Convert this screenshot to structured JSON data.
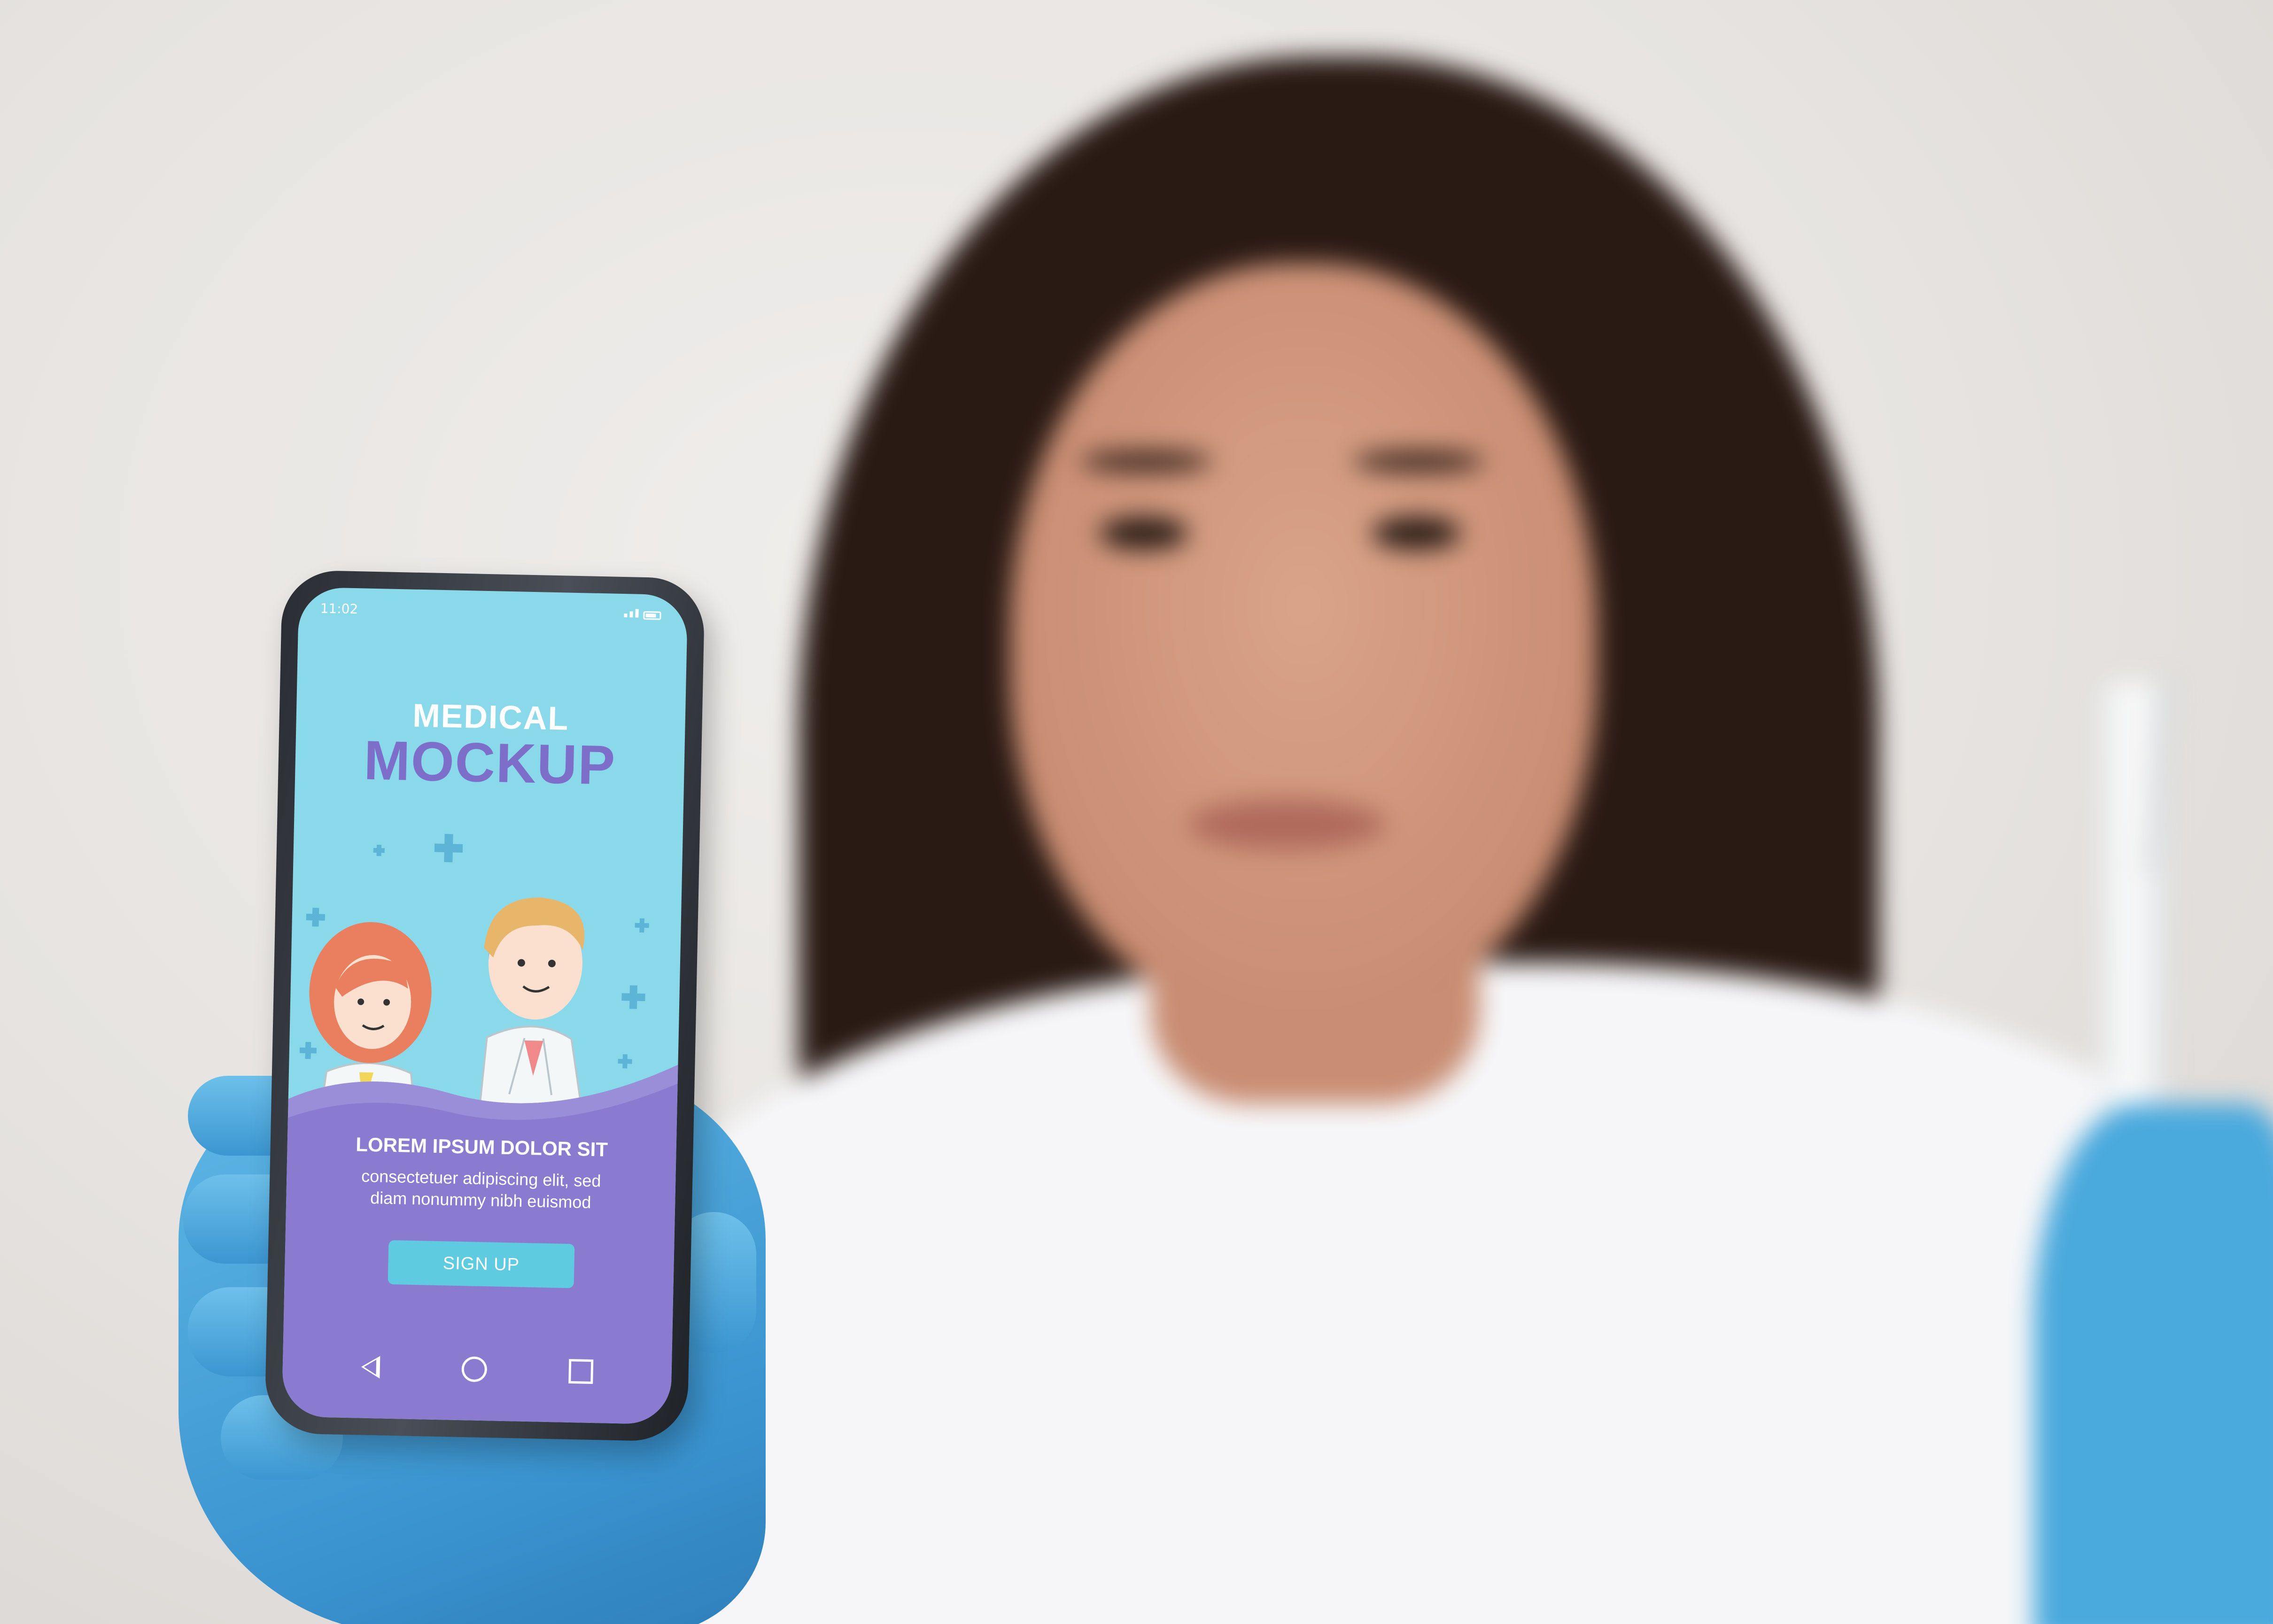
{
  "status_bar": {
    "time": "11:02"
  },
  "app": {
    "title_line1": "MEDICAL",
    "title_line2": "MOCKUP",
    "heading": "LOREM IPSUM DOLOR SIT",
    "body_line1": "consectetuer adipiscing elit, sed",
    "body_line2": "diam nonummy nibh euismod",
    "signup_label": "SIGN UP"
  },
  "icons": {
    "nav_back": "triangle-back-icon",
    "nav_home": "circle-home-icon",
    "nav_recents": "square-recents-icon",
    "signal": "signal-icon",
    "battery": "battery-icon"
  },
  "colors": {
    "screen_top": "#8ad9ea",
    "panel_purple": "#8b7bd0",
    "title_purple": "#7c6ec9",
    "button_cyan": "#5fcbe0",
    "glove_blue": "#4aa9dd"
  }
}
